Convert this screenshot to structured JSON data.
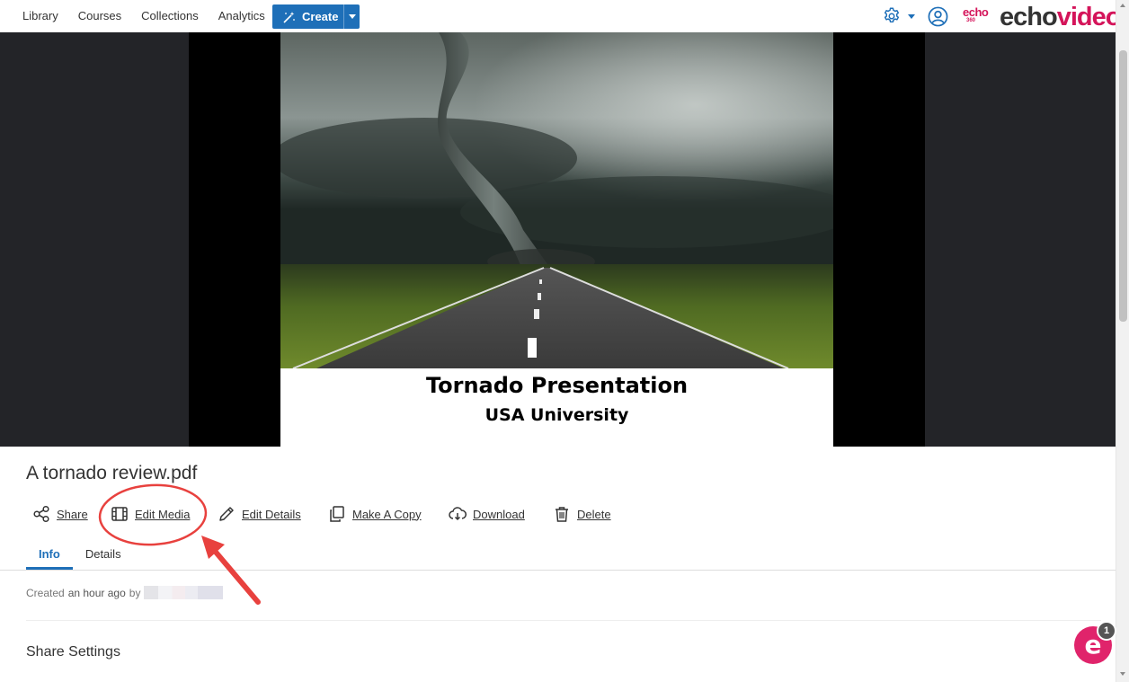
{
  "nav": {
    "items": [
      "Library",
      "Courses",
      "Collections",
      "Analytics"
    ],
    "create_label": "Create"
  },
  "brand": {
    "echo": "echo",
    "echo360": "360",
    "echo_part": "echo",
    "video_part": "video",
    "accent": "#d4145a",
    "primary": "#1e6fb8"
  },
  "player": {
    "slide_title": "Tornado Presentation",
    "slide_subtitle": "USA University"
  },
  "media": {
    "title": "A tornado review.pdf",
    "actions": {
      "share": "Share",
      "edit_media": "Edit Media",
      "edit_details": "Edit Details",
      "make_copy": "Make A Copy",
      "download": "Download",
      "delete": "Delete"
    },
    "tabs": {
      "info": "Info",
      "details": "Details"
    },
    "created_prefix": "Created",
    "created_ago": "an hour ago",
    "created_by": "by",
    "share_settings": "Share Settings"
  },
  "help": {
    "badge": "1",
    "glyph": "e"
  }
}
